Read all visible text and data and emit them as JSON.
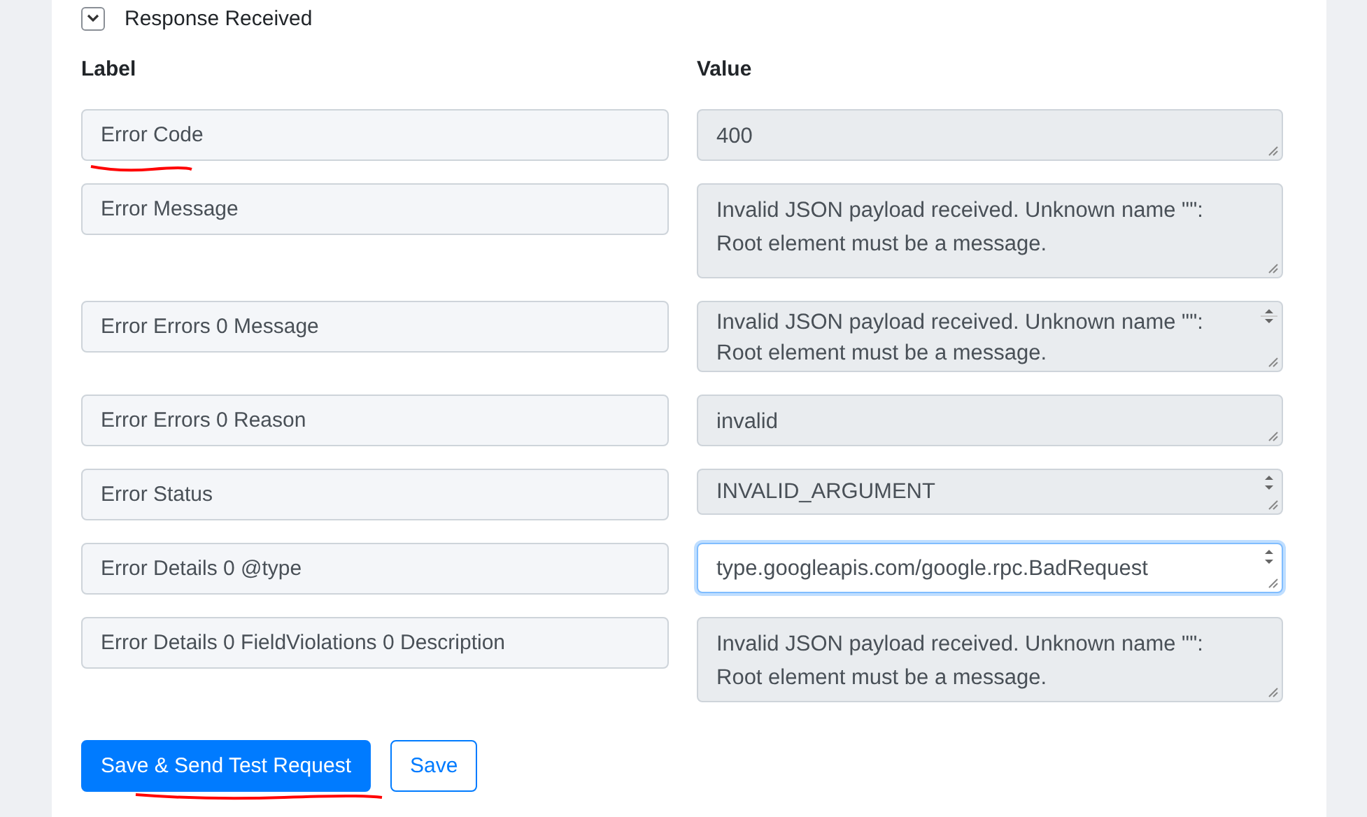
{
  "section": {
    "title": "Response Received",
    "expanded": true
  },
  "columns": {
    "label": "Label",
    "value": "Value"
  },
  "rows": [
    {
      "label": "Error Code",
      "value": "400",
      "kind": "short",
      "focused": false,
      "underlined": true
    },
    {
      "label": "Error Message",
      "value": "Invalid JSON payload received. Unknown name \"\": Root element must be a message.",
      "kind": "tall",
      "focused": false,
      "underlined": false
    },
    {
      "label": "Error Errors 0 Message",
      "value": "Invalid JSON payload received. Unknown name \"\": Root element must be a message.",
      "kind": "scroll",
      "focused": false,
      "underlined": false
    },
    {
      "label": "Error Errors 0 Reason",
      "value": "invalid",
      "kind": "short",
      "focused": false,
      "underlined": false
    },
    {
      "label": "Error Status",
      "value": "INVALID_ARGUMENT",
      "kind": "spin",
      "focused": false,
      "underlined": false
    },
    {
      "label": "Error Details 0 @type",
      "value": "type.googleapis.com/google.rpc.BadRequest",
      "kind": "spin",
      "focused": true,
      "underlined": false
    },
    {
      "label": "Error Details 0 FieldViolations 0 Description",
      "value": "Invalid JSON payload received. Unknown name \"\": Root element must be a message.",
      "kind": "wrap",
      "focused": false,
      "underlined": false
    }
  ],
  "buttons": [
    {
      "label": "Save & Send Test Request",
      "kind": "primary",
      "underlined": true
    },
    {
      "label": "Save",
      "kind": "outline",
      "underlined": false
    }
  ]
}
